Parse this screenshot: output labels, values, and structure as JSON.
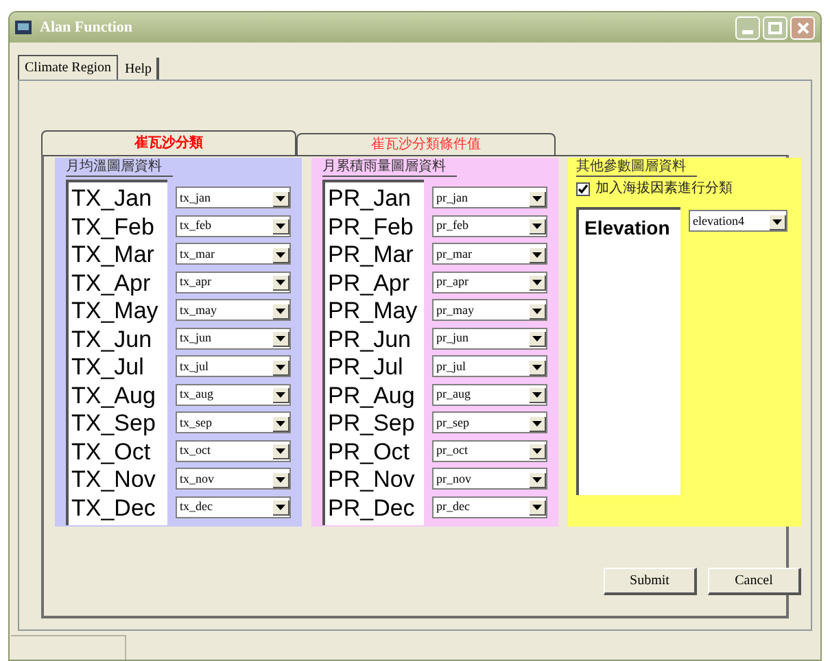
{
  "window": {
    "title": "Alan Function"
  },
  "tabs": [
    {
      "label": "Climate Region",
      "selected": true
    },
    {
      "label": "Help",
      "selected": false
    }
  ],
  "inner_tabs": [
    {
      "label": "崔瓦沙分類",
      "selected": true
    },
    {
      "label": "崔瓦沙分類條件值",
      "selected": false
    }
  ],
  "groups": [
    {
      "title": "月均溫圖層資料",
      "color": "#c8c8f8",
      "rows": [
        {
          "label": "TX_Jan",
          "value": "tx_jan"
        },
        {
          "label": "TX_Feb",
          "value": "tx_feb"
        },
        {
          "label": "TX_Mar",
          "value": "tx_mar"
        },
        {
          "label": "TX_Apr",
          "value": "tx_apr"
        },
        {
          "label": "TX_May",
          "value": "tx_may"
        },
        {
          "label": "TX_Jun",
          "value": "tx_jun"
        },
        {
          "label": "TX_Jul",
          "value": "tx_jul"
        },
        {
          "label": "TX_Aug",
          "value": "tx_aug"
        },
        {
          "label": "TX_Sep",
          "value": "tx_sep"
        },
        {
          "label": "TX_Oct",
          "value": "tx_oct"
        },
        {
          "label": "TX_Nov",
          "value": "tx_nov"
        },
        {
          "label": "TX_Dec",
          "value": "tx_dec"
        }
      ]
    },
    {
      "title": "月累積雨量圖層資料",
      "color": "#f8c8f8",
      "rows": [
        {
          "label": "PR_Jan",
          "value": "pr_jan"
        },
        {
          "label": "PR_Feb",
          "value": "pr_feb"
        },
        {
          "label": "PR_Mar",
          "value": "pr_mar"
        },
        {
          "label": "PR_Apr",
          "value": "pr_apr"
        },
        {
          "label": "PR_May",
          "value": "pr_may"
        },
        {
          "label": "PR_Jun",
          "value": "pr_jun"
        },
        {
          "label": "PR_Jul",
          "value": "pr_jul"
        },
        {
          "label": "PR_Aug",
          "value": "pr_aug"
        },
        {
          "label": "PR_Sep",
          "value": "pr_sep"
        },
        {
          "label": "PR_Oct",
          "value": "pr_oct"
        },
        {
          "label": "PR_Nov",
          "value": "pr_nov"
        },
        {
          "label": "PR_Dec",
          "value": "pr_dec"
        }
      ]
    }
  ],
  "other": {
    "title": "其他參數圖層資料",
    "color": "#ffff66",
    "checkbox": {
      "label": "加入海拔因素進行分類",
      "checked": true
    },
    "rows": [
      {
        "label": "Elevation",
        "value": "elevation4"
      }
    ]
  },
  "buttons": [
    "Submit",
    "Cancel"
  ]
}
